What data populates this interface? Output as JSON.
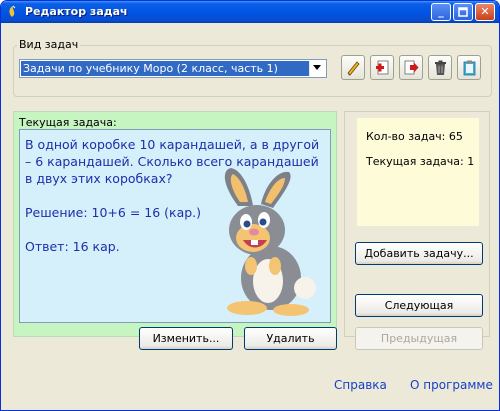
{
  "window": {
    "title": "Редактор задач",
    "controls": [
      "minimize-icon",
      "maximize-icon",
      "close-icon"
    ]
  },
  "task_type": {
    "legend": "Вид задач",
    "selected": "Задачи по учебнику Моро (2 класс, часть 1)"
  },
  "toolbar": {
    "icons": [
      "pencil-icon",
      "add-file-icon",
      "export-icon",
      "trash-icon",
      "clipboard-icon"
    ]
  },
  "current_task": {
    "caption": "Текущая задача:",
    "text": "В одной коробке 10 карандашей, а в другой – 6 карандашей. Сколько всего карандашей в двух этих коробках?",
    "solution": "Решение:  10+6 = 16 (кар.)",
    "answer": "Ответ:  16 кар."
  },
  "buttons": {
    "edit": "Изменить...",
    "delete": "Удалить",
    "add": "Добавить задачу...",
    "next": "Следующая",
    "prev": "Предыдущая"
  },
  "info": {
    "count": "Кол-во задач: 65",
    "current": "Текущая задача: 1"
  },
  "links": {
    "help": "Справка",
    "about": "О программе"
  },
  "colors": {
    "titlebar": "#0054e3",
    "task_panel": "#c6f5c2",
    "task_box": "#d5f0fb",
    "task_text": "#1d2faa",
    "info_box": "#fdfbd8",
    "link": "#1740c8"
  }
}
